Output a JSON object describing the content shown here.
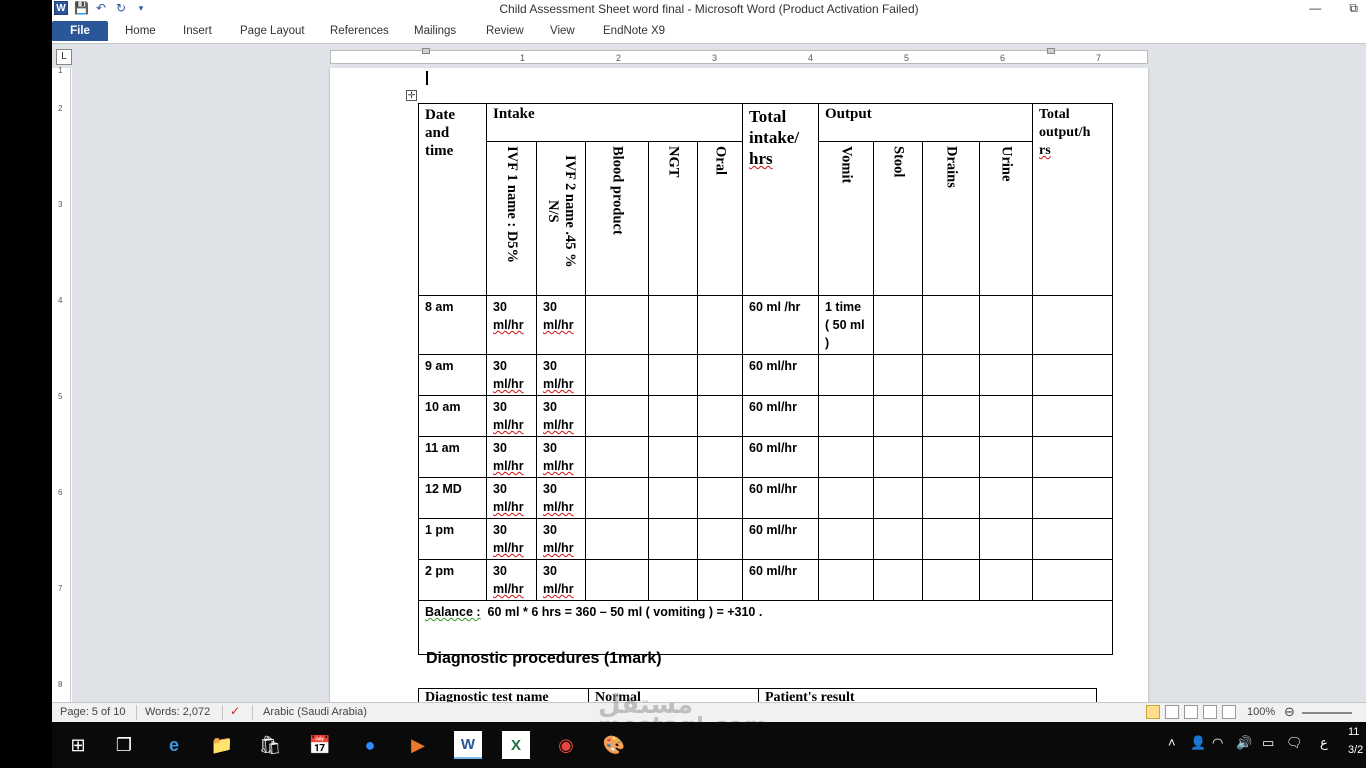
{
  "window": {
    "title": "Child Assessment Sheet word final  -  Microsoft Word (Product Activation Failed)",
    "word_icon": "W",
    "undo_icon": "undo-icon",
    "minimize": "—",
    "restore": "⧉"
  },
  "ribbon": {
    "tabs": [
      "File",
      "Home",
      "Insert",
      "Page Layout",
      "References",
      "Mailings",
      "Review",
      "View",
      "EndNote X9"
    ]
  },
  "ruler": {
    "corner": "L",
    "h_numbers": [
      "1",
      "2",
      "3",
      "4",
      "5",
      "6",
      "7"
    ],
    "v_numbers": [
      "1",
      "2",
      "3",
      "4",
      "5",
      "6",
      "7",
      "8"
    ]
  },
  "io_table": {
    "h_date": "Date and time",
    "h_intake": "Intake",
    "h_total_intake": "Total intake/",
    "h_total_intake_b": "hrs",
    "h_output": "Output",
    "h_total_output": "Total output/h",
    "h_total_output_b": "rs",
    "sub_intake": [
      "IVF 1 name : D5%",
      "IVF 2 name .45 % N/S",
      "Blood product",
      "NGT",
      "Oral"
    ],
    "sub_output": [
      "Vomit",
      "Stool",
      "Drains",
      "Urine"
    ],
    "rows": [
      {
        "time": "8 am",
        "ivf1": "30",
        "ivf2": "30",
        "unit": "ml/hr",
        "total": "60 ml /hr",
        "vomit": "1 time ( 50 ml )"
      },
      {
        "time": "9 am",
        "ivf1": "30",
        "ivf2": "30",
        "unit": "ml/hr",
        "total": "60 ml/hr",
        "vomit": ""
      },
      {
        "time": "10 am",
        "ivf1": "30",
        "ivf2": "30",
        "unit": "ml/hr",
        "total": "60 ml/hr",
        "vomit": ""
      },
      {
        "time": "11 am",
        "ivf1": "30",
        "ivf2": "30",
        "unit": "ml/hr",
        "total": "60 ml/hr",
        "vomit": ""
      },
      {
        "time": "12 MD",
        "ivf1": "30",
        "ivf2": "30",
        "unit": "ml/hr",
        "total": "60 ml/hr",
        "vomit": ""
      },
      {
        "time": "1 pm",
        "ivf1": "30",
        "ivf2": "30",
        "unit": "ml/hr",
        "total": "60 ml/hr",
        "vomit": ""
      },
      {
        "time": "2 pm",
        "ivf1": "30",
        "ivf2": "30",
        "unit": "ml/hr",
        "total": "60 ml/hr",
        "vomit": ""
      }
    ],
    "balance_label": "Balance :",
    "balance_text": "60 ml * 6 hrs = 360 – 50 ml ( vomiting ) = +310 ."
  },
  "diagnostic": {
    "heading": "Diagnostic procedures (1mark)",
    "headers": [
      "Diagnostic test name",
      "Normal",
      "Patient's result"
    ]
  },
  "statusbar": {
    "page": "Page: 5 of 10",
    "words": "Words: 2,072",
    "language": "Arabic (Saudi Arabia)",
    "zoom": "100%"
  },
  "watermark": {
    "arabic": "مستقل",
    "latin": "mostaql.com"
  },
  "taskbar": {
    "clock_time": "11",
    "clock_date": "3/2",
    "lang": "ع"
  }
}
